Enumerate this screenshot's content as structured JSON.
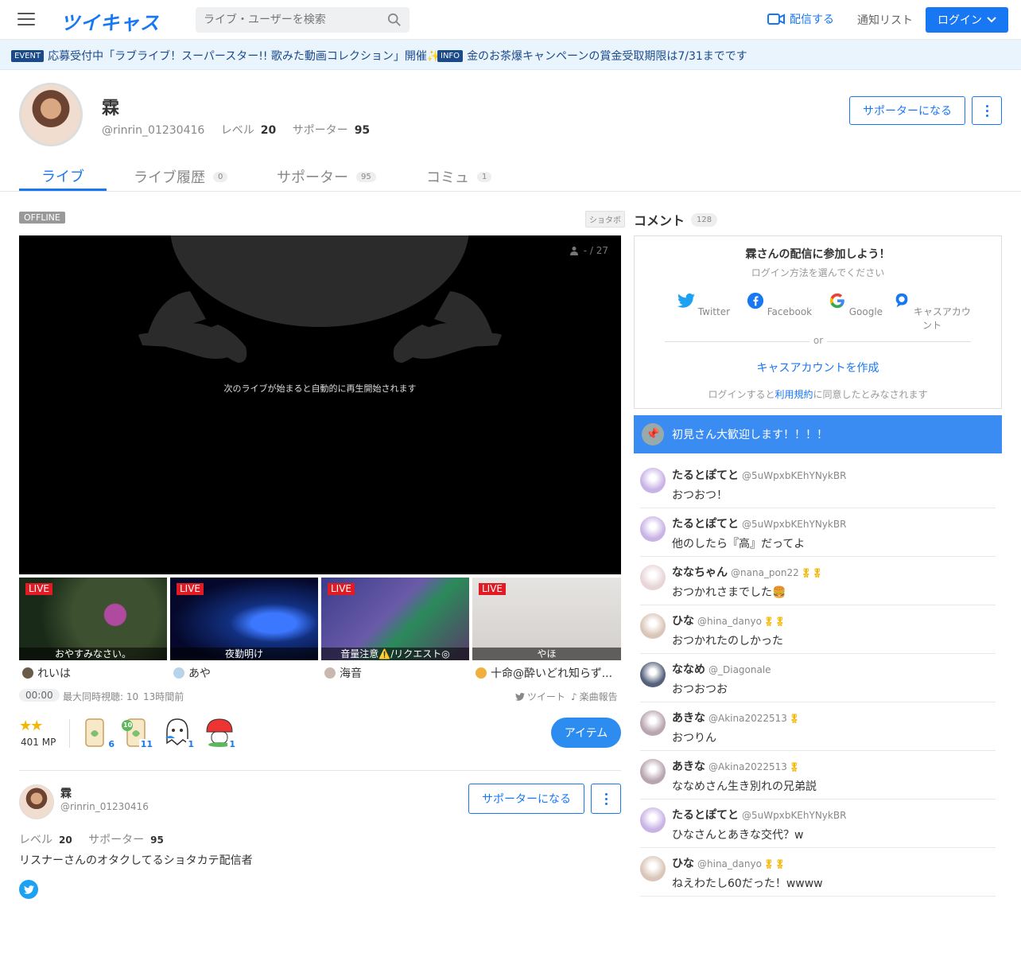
{
  "header": {
    "logo": "ツイキャス",
    "search_placeholder": "ライブ・ユーザーを検索",
    "broadcast_label": "配信する",
    "notify_label": "通知リスト",
    "login_label": "ログイン"
  },
  "events": [
    {
      "tag": "EVENT",
      "text": "応募受付中「ラブライブ！スーパースター!! 歌みた動画コレクション」開催✨"
    },
    {
      "tag": "INFO",
      "text": "金のお茶爆キャンペーンの賞金受取期限は7/31までです"
    }
  ],
  "profile": {
    "name": "霖",
    "handle": "@rinrin_01230416",
    "level_label": "レベル",
    "level": "20",
    "supporter_label": "サポーター",
    "supporters": "95",
    "supporter_button": "サポーターになる"
  },
  "tabs": [
    {
      "label": "ライブ",
      "count": ""
    },
    {
      "label": "ライブ履歴",
      "count": "0"
    },
    {
      "label": "サポーター",
      "count": "95"
    },
    {
      "label": "コミュ",
      "count": "1"
    }
  ],
  "player": {
    "status": "OFFLINE",
    "category": "ショタボ",
    "viewers": "- / 27",
    "message": "次のライブが始まると自動的に再生開始されます"
  },
  "recommended": [
    {
      "badge": "LIVE",
      "caption": "おやすみなさい。",
      "user": "れいは"
    },
    {
      "badge": "LIVE",
      "caption": "夜勤明け",
      "user": "あや"
    },
    {
      "badge": "LIVE",
      "caption": "音量注意⚠️/リクエスト◎",
      "user": "海音"
    },
    {
      "badge": "LIVE",
      "caption": "やほ",
      "user": "十命@酔いどれ知らず..."
    }
  ],
  "stats": {
    "time": "00:00",
    "max_viewers": "最大同時視聴: 10",
    "ago": "13時間前",
    "tweet": "ツイート",
    "song_report": "楽曲報告"
  },
  "items": {
    "mp": "401 MP",
    "gifts": [
      "6",
      "11",
      "1",
      "1"
    ],
    "gift_badge": "10",
    "item_button": "アイテム"
  },
  "owner": {
    "name": "霖",
    "handle": "@rinrin_01230416",
    "level_label": "レベル",
    "level": "20",
    "supporter_label": "サポーター",
    "supporters": "95",
    "supporter_button": "サポーターになる",
    "bio": "リスナーさんのオタクしてるショタカテ配信者"
  },
  "comments_panel": {
    "title": "コメント",
    "count": "128",
    "join_title": "霖さんの配信に参加しよう！",
    "join_subtitle": "ログイン方法を選んでください",
    "sns": [
      "Twitter",
      "Facebook",
      "Google",
      "キャスアカウント"
    ],
    "or": "or",
    "create_account": "キャスアカウントを作成",
    "terms_prefix": "ログインすると",
    "terms_link": "利用規約",
    "terms_suffix": "に同意したとみなされます",
    "pinned": "初見さん大歓迎します！！！！"
  },
  "comments": [
    {
      "name": "たるとぽてと",
      "uid": "@5uWpxbKEhYNykBR",
      "medal": "",
      "text": "おつおつ！",
      "color": "#c9b3e6"
    },
    {
      "name": "たるとぽてと",
      "uid": "@5uWpxbKEhYNykBR",
      "medal": "",
      "text": "他のしたら『高』だってよ",
      "color": "#c9b3e6"
    },
    {
      "name": "ななちゃん",
      "uid": "@nana_pon22",
      "medal": "🎖🎖",
      "text": "おつかれさまでした🍔",
      "color": "#e8d5d8"
    },
    {
      "name": "ひな",
      "uid": "@hina_danyo",
      "medal": "🎖🎖",
      "text": "おつかれたのしかった",
      "color": "#d9c6b8"
    },
    {
      "name": "ななめ",
      "uid": "@_Diagonale",
      "medal": "",
      "text": "おつおつお",
      "color": "#55607a"
    },
    {
      "name": "あきな",
      "uid": "@Akina2022513",
      "medal": "🎖",
      "text": "おつりん",
      "color": "#b8a5b0"
    },
    {
      "name": "あきな",
      "uid": "@Akina2022513",
      "medal": "🎖",
      "text": "ななめさん生き別れの兄弟説",
      "color": "#b8a5b0"
    },
    {
      "name": "たるとぽてと",
      "uid": "@5uWpxbKEhYNykBR",
      "medal": "",
      "text": "ひなさんとあきな交代？w",
      "color": "#c9b3e6"
    },
    {
      "name": "ひな",
      "uid": "@hina_danyo",
      "medal": "🎖🎖",
      "text": "ねえわたし60だった！wwww",
      "color": "#d9c6b8"
    }
  ]
}
